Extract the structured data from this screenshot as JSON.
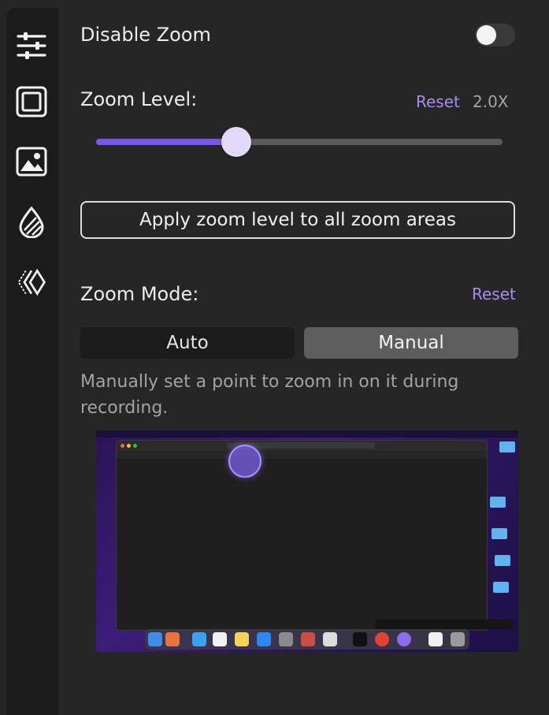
{
  "sidebar": {
    "items": [
      {
        "icon": "sliders-icon"
      },
      {
        "icon": "frame-icon"
      },
      {
        "icon": "image-icon"
      },
      {
        "icon": "drop-icon"
      },
      {
        "icon": "chevrons-icon"
      }
    ]
  },
  "zoom": {
    "disable_label": "Disable Zoom",
    "disable_enabled": false,
    "level_label": "Zoom Level:",
    "level_reset": "Reset",
    "level_value": "2.0X",
    "slider_fraction": 0.345,
    "apply_label": "Apply zoom level to all zoom areas",
    "mode_label": "Zoom Mode:",
    "mode_reset": "Reset",
    "mode_options": [
      "Auto",
      "Manual"
    ],
    "mode_selected": "Manual",
    "mode_description": "Manually set a point to zoom in on it during recording."
  },
  "colors": {
    "accent": "#7a55e8",
    "link": "#a98bef",
    "background": "#262626",
    "sidebar": "#1b1b1b"
  }
}
